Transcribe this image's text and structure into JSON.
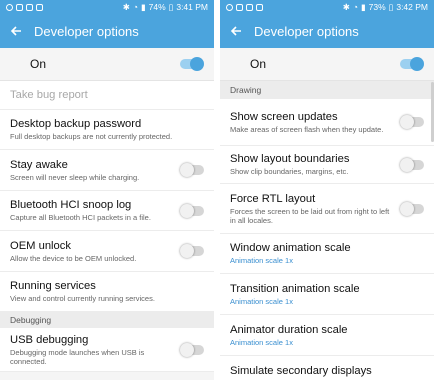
{
  "left": {
    "status": {
      "battery": "74%",
      "time": "3:41 PM"
    },
    "title": "Developer options",
    "master": {
      "label": "On",
      "on": true
    },
    "items": [
      {
        "title": "Take bug report",
        "disabled": true
      },
      {
        "title": "Desktop backup password",
        "subtitle": "Full desktop backups are not currently protected."
      },
      {
        "title": "Stay awake",
        "subtitle": "Screen will never sleep while charging.",
        "toggle": false
      },
      {
        "title": "Bluetooth HCI snoop log",
        "subtitle": "Capture all Bluetooth HCI packets in a file.",
        "toggle": false
      },
      {
        "title": "OEM unlock",
        "subtitle": "Allow the device to be OEM unlocked.",
        "toggle": false
      },
      {
        "title": "Running services",
        "subtitle": "View and control currently running services."
      }
    ],
    "section": "Debugging",
    "debug_item": {
      "title": "USB debugging",
      "subtitle": "Debugging mode launches when USB is connected.",
      "toggle": false
    }
  },
  "right": {
    "status": {
      "battery": "73%",
      "time": "3:42 PM"
    },
    "title": "Developer options",
    "master": {
      "label": "On",
      "on": true
    },
    "section": "Drawing",
    "items": [
      {
        "title": "Show screen updates",
        "subtitle": "Make areas of screen flash when they update.",
        "toggle": false
      },
      {
        "title": "Show layout boundaries",
        "subtitle": "Show clip boundaries, margins, etc.",
        "toggle": false
      },
      {
        "title": "Force RTL layout",
        "subtitle": "Forces the screen to be laid out from right to left in all locales.",
        "toggle": false
      },
      {
        "title": "Window animation scale",
        "value": "Animation scale 1x"
      },
      {
        "title": "Transition animation scale",
        "value": "Animation scale 1x"
      },
      {
        "title": "Animator duration scale",
        "value": "Animation scale 1x"
      },
      {
        "title": "Simulate secondary displays"
      }
    ]
  },
  "colors": {
    "accent": "#4ba4dd",
    "toggle_on_track": "#9cd0f0",
    "background": "#f5f5f5"
  }
}
